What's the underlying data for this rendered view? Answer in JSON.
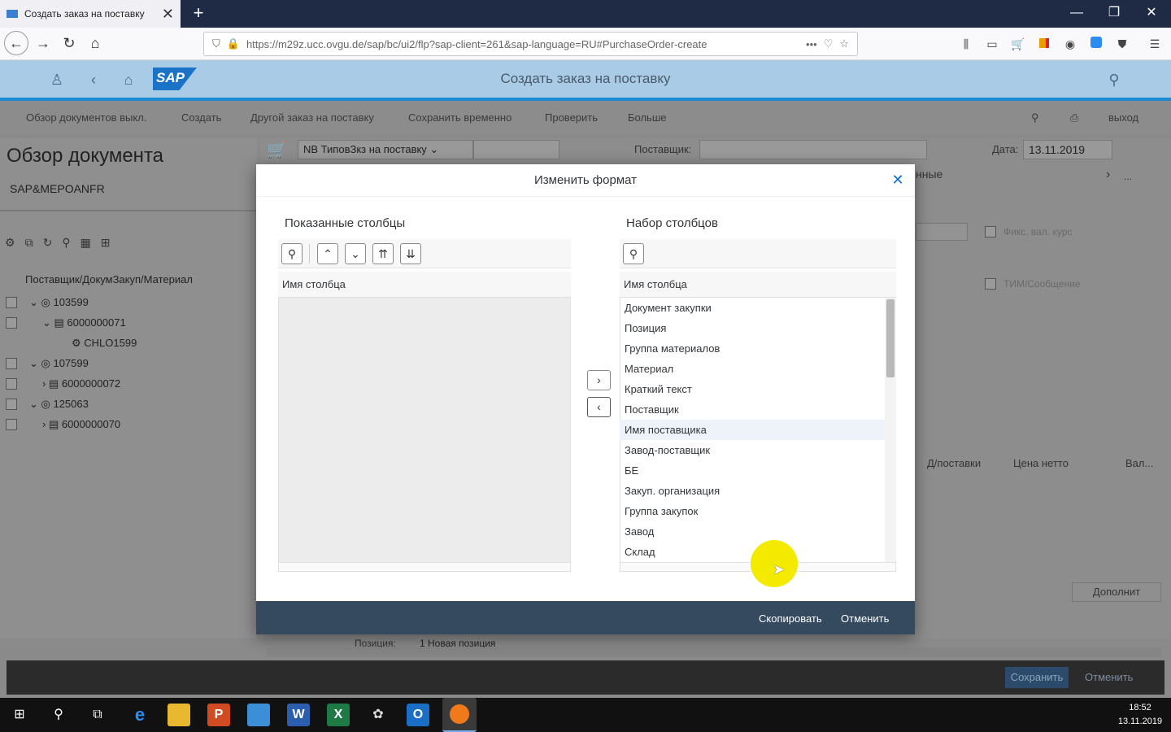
{
  "browser": {
    "tab_title": "Создать заказ на поставку",
    "url": "https://m29z.ucc.ovgu.de/sap/bc/ui2/flp?sap-client=261&sap-language=RU#PurchaseOrder-create"
  },
  "shell": {
    "title": "Создать заказ на поставку",
    "logo": "SAP"
  },
  "toolbar": {
    "items": [
      "Обзор документов выкл.",
      "Создать",
      "Другой заказ на поставку",
      "Сохранить временно",
      "Проверить",
      "Больше"
    ],
    "exit": "выход"
  },
  "document": {
    "title": "Обзор документа",
    "subtitle": "SAP&MEPOANFR",
    "tree_header": "Поставщик/ДокумЗакуп/Материал",
    "tree": [
      {
        "label": "103599",
        "level": 0
      },
      {
        "label": "6000000071",
        "level": 1
      },
      {
        "label": "CHLO1599",
        "level": 2
      },
      {
        "label": "107599",
        "level": 0
      },
      {
        "label": "6000000072",
        "level": 1
      },
      {
        "label": "125063",
        "level": 0
      },
      {
        "label": "6000000070",
        "level": 1
      }
    ]
  },
  "header_area": {
    "order_type": "NB ТиповЗкз на поставку",
    "supplier_label": "Поставщик:",
    "date_label": "Дата:",
    "date_value": "13.11.2019",
    "tab_partial": "нные",
    "fixed_rate": "Фикс. вал. курс",
    "tim_messages": "ТИМ/Сообщение",
    "col_delivery": "Д/поставки",
    "col_net_price": "Цена нетто",
    "col_currency": "Вал...",
    "more_button": "Дополнит",
    "position_label": "Позиция:",
    "position_value": "1 Новая позиция"
  },
  "dialog": {
    "title": "Изменить формат",
    "left_panel_title": "Показанные столбцы",
    "right_panel_title": "Набор столбцов",
    "column_header": "Имя столбца",
    "available_columns": [
      "Документ закупки",
      "Позиция",
      "Группа материалов",
      "Материал",
      "Краткий текст",
      "Поставщик",
      "Имя поставщика",
      "Завод-поставщик",
      "БЕ",
      "Закуп. организация",
      "Группа закупок",
      "Завод",
      "Склад"
    ],
    "copy_button": "Скопировать",
    "cancel_button": "Отменить"
  },
  "footer": {
    "save": "Сохранить",
    "cancel": "Отменить"
  },
  "taskbar": {
    "time": "18:52",
    "date": "13.11.2019"
  }
}
